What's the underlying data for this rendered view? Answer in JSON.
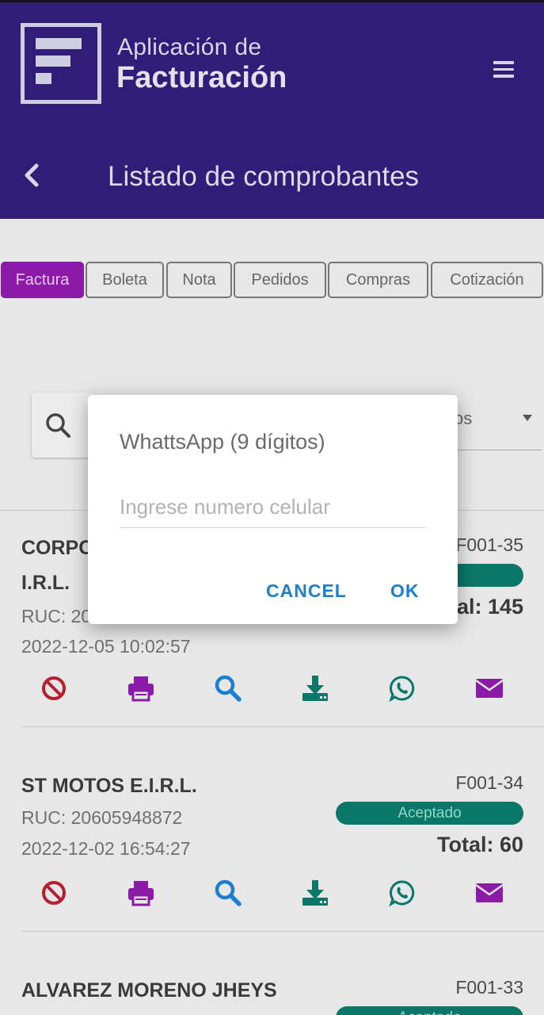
{
  "header": {
    "brand_line1": "Aplicación de",
    "brand_line2": "Facturación",
    "page_title": "Listado de comprobantes"
  },
  "tabs": [
    {
      "label": "Factura",
      "active": true
    },
    {
      "label": "Boleta",
      "active": false
    },
    {
      "label": "Nota",
      "active": false
    },
    {
      "label": "Pedidos",
      "active": false
    },
    {
      "label": "Compras",
      "active": false
    },
    {
      "label": "Cotización",
      "active": false
    }
  ],
  "filter": {
    "visible_fragment": "os"
  },
  "cards": [
    {
      "name_line1": "CORPO",
      "name_line2": "I.R.L.",
      "ruc": "RUC: 20",
      "date": "2022-12-05 10:02:57",
      "code": "F001-35",
      "status": "o",
      "total": "al: 145"
    },
    {
      "name_line1": "ST MOTOS E.I.R.L.",
      "ruc": "RUC: 20605948872",
      "date": "2022-12-02 16:54:27",
      "code": "F001-34",
      "status": "Aceptado",
      "total": "Total: 60"
    },
    {
      "name_line1": "ALVAREZ MORENO JHEYS",
      "code": "F001-33",
      "status": "Aceptado"
    }
  ],
  "colors": {
    "header_bg": "#2f1d78",
    "tab_active": "#8a1aa7",
    "badge": "#0a7768",
    "icon_cancel": "#b41e2e",
    "icon_print": "#8a1aa7",
    "icon_search": "#1a7fd0",
    "icon_download": "#0a7768",
    "icon_whatsapp": "#0a7768",
    "icon_mail": "#8a1aa7",
    "dialog_button": "#1a7fd0"
  },
  "dialog": {
    "title": "WhattsApp (9 dígitos)",
    "input_placeholder": "Ingrese numero celular",
    "input_value": "",
    "cancel_label": "CANCEL",
    "ok_label": "OK"
  }
}
